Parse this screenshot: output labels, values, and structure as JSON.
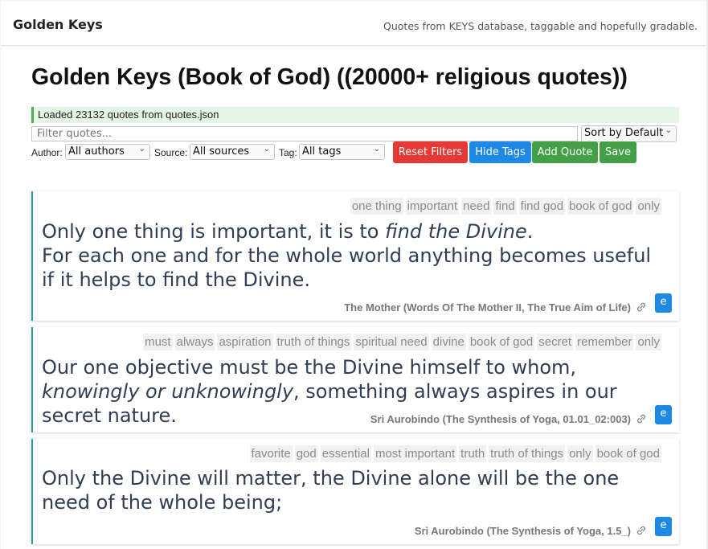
{
  "header": {
    "brand": "Golden Keys",
    "tagline": "Quotes from KEYS database, taggable and hopefully gradable."
  },
  "page": {
    "title": "Golden Keys (Book of God) ((20000+ religious quotes))",
    "status": "Loaded 23132 quotes from quotes.json"
  },
  "controls": {
    "filter_placeholder": "Filter quotes...",
    "filter_value": "",
    "sort_value": "Sort by Default",
    "author_label": "Author:",
    "author_value": "All authors",
    "source_label": "Source:",
    "source_value": "All sources",
    "tag_label": "Tag:",
    "tag_value": "All tags",
    "reset_label": "Reset Filters",
    "hide_tags_label": "Hide Tags",
    "add_quote_label": "Add Quote",
    "save_label": "Save",
    "colors": {
      "reset": "#e53935",
      "hide_tags": "#1e88e5",
      "add_quote": "#43a047",
      "save": "#43a047",
      "edit": "#1e88e5",
      "card_border": "#2aa198",
      "status_bg": "#e4f5e4"
    }
  },
  "quotes": [
    {
      "tags": [
        "one thing",
        "important",
        "need",
        "find",
        "find god",
        "book of god",
        "only"
      ],
      "text_1": "Only one thing is important, it is to ",
      "text_em": "find the Divine",
      "text_2": ".",
      "text_3": "For each one and for the whole world anything becomes useful if it helps to find the Divine.",
      "attribution": "The Mother (Words Of The Mother II, The True Aim of Life)",
      "edit_label": "e",
      "link_icon": "link-icon"
    },
    {
      "tags": [
        "must",
        "always",
        "aspiration",
        "truth of things",
        "spiritual need",
        "divine",
        "book of god",
        "secret",
        "remember",
        "only"
      ],
      "text_1": "Our one objective must be the Divine himself to whom, ",
      "text_em": "knowingly or unknowingly",
      "text_2": ", something always aspires in our secret nature.",
      "attribution": "Sri Aurobindo (The Synthesis of Yoga, 01.01_02:003)",
      "edit_label": "e",
      "link_icon": "link-icon"
    },
    {
      "tags": [
        "favorite",
        "god",
        "essential",
        "most important",
        "truth",
        "truth of things",
        "only",
        "book of god"
      ],
      "text_1": "Only the Divine will matter, the Divine alone will be the one need of the whole being;",
      "attribution": "Sri Aurobindo (The Synthesis of Yoga, 1.5_)",
      "edit_label": "e",
      "link_icon": "link-icon"
    }
  ]
}
